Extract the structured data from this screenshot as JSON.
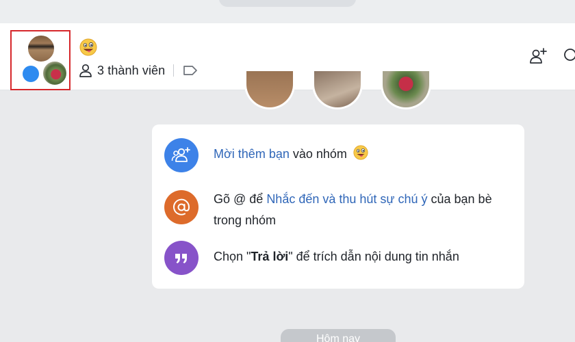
{
  "header": {
    "member_count_label": "3 thành viên",
    "group_emoji": "😜"
  },
  "tips": [
    {
      "icon": "add-user-icon",
      "color": "#3d82e8",
      "link": "Mời thêm bạn",
      "text_after": " vào nhóm ",
      "emoji": "😜"
    },
    {
      "icon": "at-sign-icon",
      "color": "#dd6b2b",
      "text_before": "Gõ @ để ",
      "link": "Nhắc đến và thu hút sự chú ý",
      "text_after": " của bạn bè trong nhóm"
    },
    {
      "icon": "quote-icon",
      "color": "#8753c9",
      "text_before": "Chọn \"",
      "bold": "Trả lời",
      "text_after": "\" để trích dẫn nội dung tin nhắn"
    }
  ],
  "date_separator": "Hôm nay",
  "colors": {
    "highlight_border": "#d6262a",
    "link": "#2f66b8"
  }
}
